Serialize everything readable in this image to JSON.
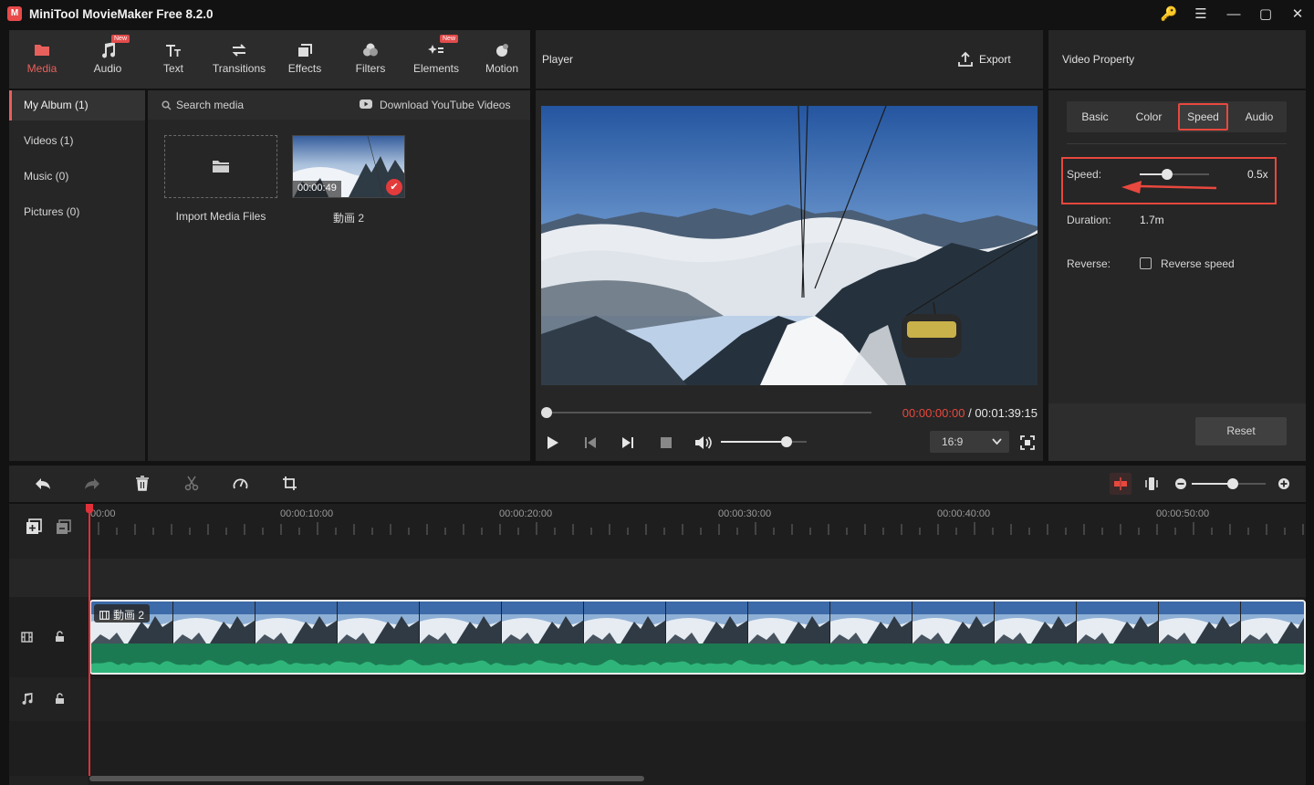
{
  "window": {
    "logo_letter": "M",
    "title": "MiniTool MovieMaker Free 8.2.0",
    "controls": {
      "key": "🔑",
      "menu": "☰",
      "minimize": "—",
      "maximize": "▢",
      "close": "✕"
    }
  },
  "toolbar": {
    "items": [
      {
        "label": "Media",
        "active": true,
        "new": false
      },
      {
        "label": "Audio",
        "active": false,
        "new": true
      },
      {
        "label": "Text",
        "active": false,
        "new": false
      },
      {
        "label": "Transitions",
        "active": false,
        "new": false
      },
      {
        "label": "Effects",
        "active": false,
        "new": false
      },
      {
        "label": "Filters",
        "active": false,
        "new": false
      },
      {
        "label": "Elements",
        "active": false,
        "new": true
      },
      {
        "label": "Motion",
        "active": false,
        "new": false
      }
    ],
    "new_badge": "New"
  },
  "sidebar": {
    "items": [
      {
        "label": "My Album (1)",
        "active": true
      },
      {
        "label": "Videos (1)",
        "active": false
      },
      {
        "label": "Music (0)",
        "active": false
      },
      {
        "label": "Pictures (0)",
        "active": false
      }
    ]
  },
  "media": {
    "search_placeholder": "Search media",
    "download_label": "Download YouTube Videos",
    "import_label": "Import Media Files",
    "clip": {
      "duration": "00:00:49",
      "name": "動画 2"
    }
  },
  "player": {
    "title": "Player",
    "export_label": "Export",
    "current_time": "00:00:00:00",
    "separator": " / ",
    "total_time": "00:01:39:15",
    "aspect_ratio": "16:9",
    "volume": 0.77,
    "progress": 0
  },
  "property": {
    "title": "Video Property",
    "tabs": [
      {
        "label": "Basic",
        "active": false
      },
      {
        "label": "Color",
        "active": false
      },
      {
        "label": "Speed",
        "active": true
      },
      {
        "label": "Audio",
        "active": false
      }
    ],
    "speed_label": "Speed:",
    "speed_value": "0.5x",
    "speed_slider": 0.4,
    "duration_label": "Duration:",
    "duration_value": "1.7m",
    "reverse_label": "Reverse:",
    "reverse_checkbox_label": "Reverse speed",
    "reset_label": "Reset"
  },
  "timeline": {
    "ruler": [
      "00:00",
      "00:00:10:00",
      "00:00:20:00",
      "00:00:30:00",
      "00:00:40:00",
      "00:00:50:00"
    ],
    "clip_name": "動画 2",
    "zoom": 0.55
  },
  "colors": {
    "accent": "#e8605c",
    "audio_wave": "#1f8a5c",
    "playhead": "#e0303a"
  }
}
